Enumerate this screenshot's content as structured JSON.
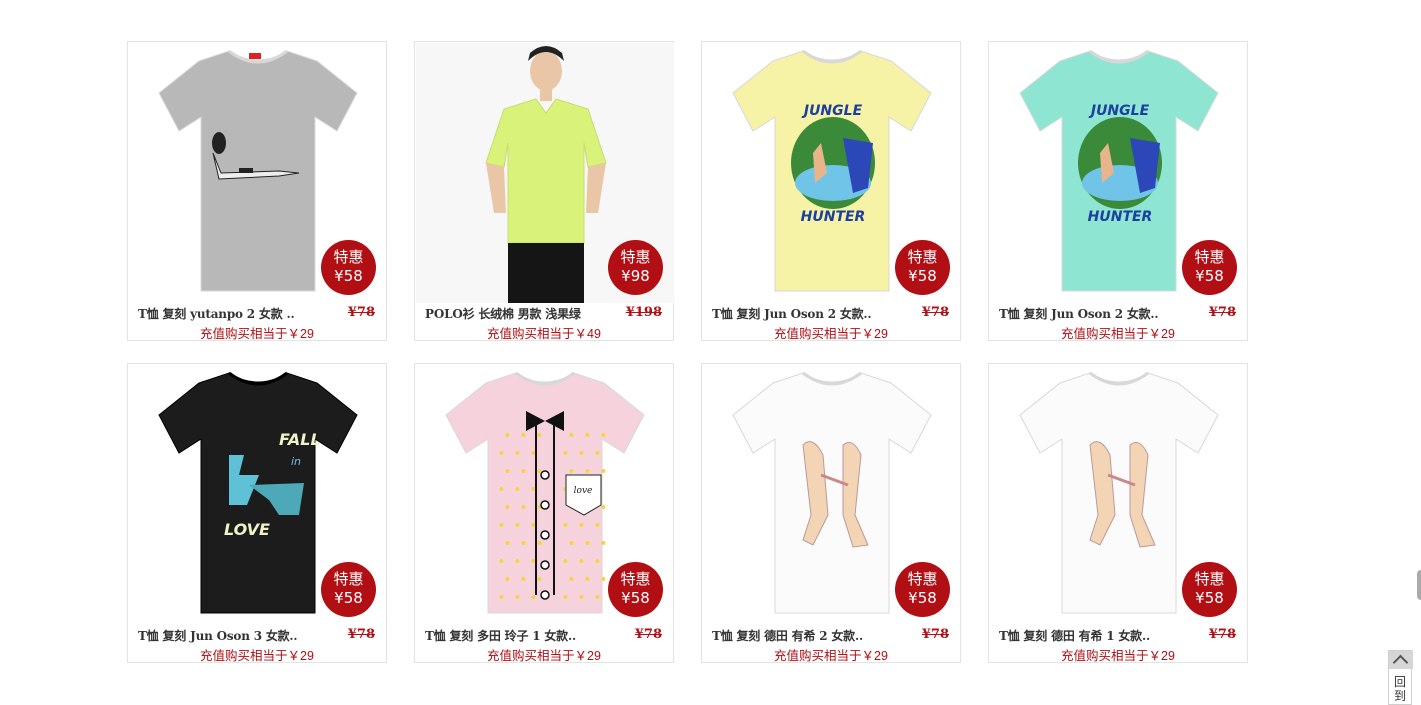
{
  "products": [
    {
      "name": "T恤 复刻 yutanpo 2 女款 ..",
      "old_price": "¥78",
      "badge_label": "特惠",
      "badge_price": "¥58",
      "promo": "充值购买相当于￥29",
      "shirt_color": "#b8b8b8",
      "print": "girl-lying",
      "icon": "tshirt-icon"
    },
    {
      "name": "POLO衫 长绒棉 男款 浅果绿",
      "old_price": "¥198",
      "badge_label": "特惠",
      "badge_price": "¥98",
      "promo": "充值购买相当于￥49",
      "shirt_color": "#d8f27a",
      "print": "model",
      "icon": "polo-icon"
    },
    {
      "name": "T恤 复刻 Jun Oson 2 女款..",
      "old_price": "¥78",
      "badge_label": "特惠",
      "badge_price": "¥58",
      "promo": "充值购买相当于￥29",
      "shirt_color": "#f6f2a6",
      "print": "jungle",
      "print_top": "JUNGLE",
      "print_bottom": "HUNTER",
      "icon": "tshirt-icon"
    },
    {
      "name": "T恤 复刻 Jun Oson 2 女款..",
      "old_price": "¥78",
      "badge_label": "特惠",
      "badge_price": "¥58",
      "promo": "充值购买相当于￥29",
      "shirt_color": "#8ee6d2",
      "print": "jungle",
      "print_top": "JUNGLE",
      "print_bottom": "HUNTER",
      "icon": "tshirt-icon"
    },
    {
      "name": "T恤 复刻 Jun Oson 3 女款..",
      "old_price": "¥78",
      "badge_label": "特惠",
      "badge_price": "¥58",
      "promo": "充值购买相当于￥29",
      "shirt_color": "#1c1c1c",
      "print": "fall",
      "print_top": "FALL",
      "print_mid": "in",
      "print_bottom": "LOVE",
      "icon": "tshirt-icon"
    },
    {
      "name": "T恤 复刻 多田 玲子 1 女款..",
      "old_price": "¥78",
      "badge_label": "特惠",
      "badge_price": "¥58",
      "promo": "充值购买相当于￥29",
      "shirt_color": "#f6d2dc",
      "print": "bowtie",
      "print_pocket": "love",
      "icon": "tshirt-icon"
    },
    {
      "name": "T恤 复刻 德田 有希 2 女款..",
      "old_price": "¥78",
      "badge_label": "特惠",
      "badge_price": "¥58",
      "promo": "充值购买相当于￥29",
      "shirt_color": "#fbfbfb",
      "print": "figures",
      "icon": "tshirt-icon"
    },
    {
      "name": "T恤 复刻 德田 有希 1 女款..",
      "old_price": "¥78",
      "badge_label": "特惠",
      "badge_price": "¥58",
      "promo": "充值购买相当于￥29",
      "shirt_color": "#fbfbfb",
      "print": "figures",
      "icon": "tshirt-icon"
    }
  ],
  "back_to_top": {
    "label_line1": "回",
    "label_line2": "到"
  }
}
